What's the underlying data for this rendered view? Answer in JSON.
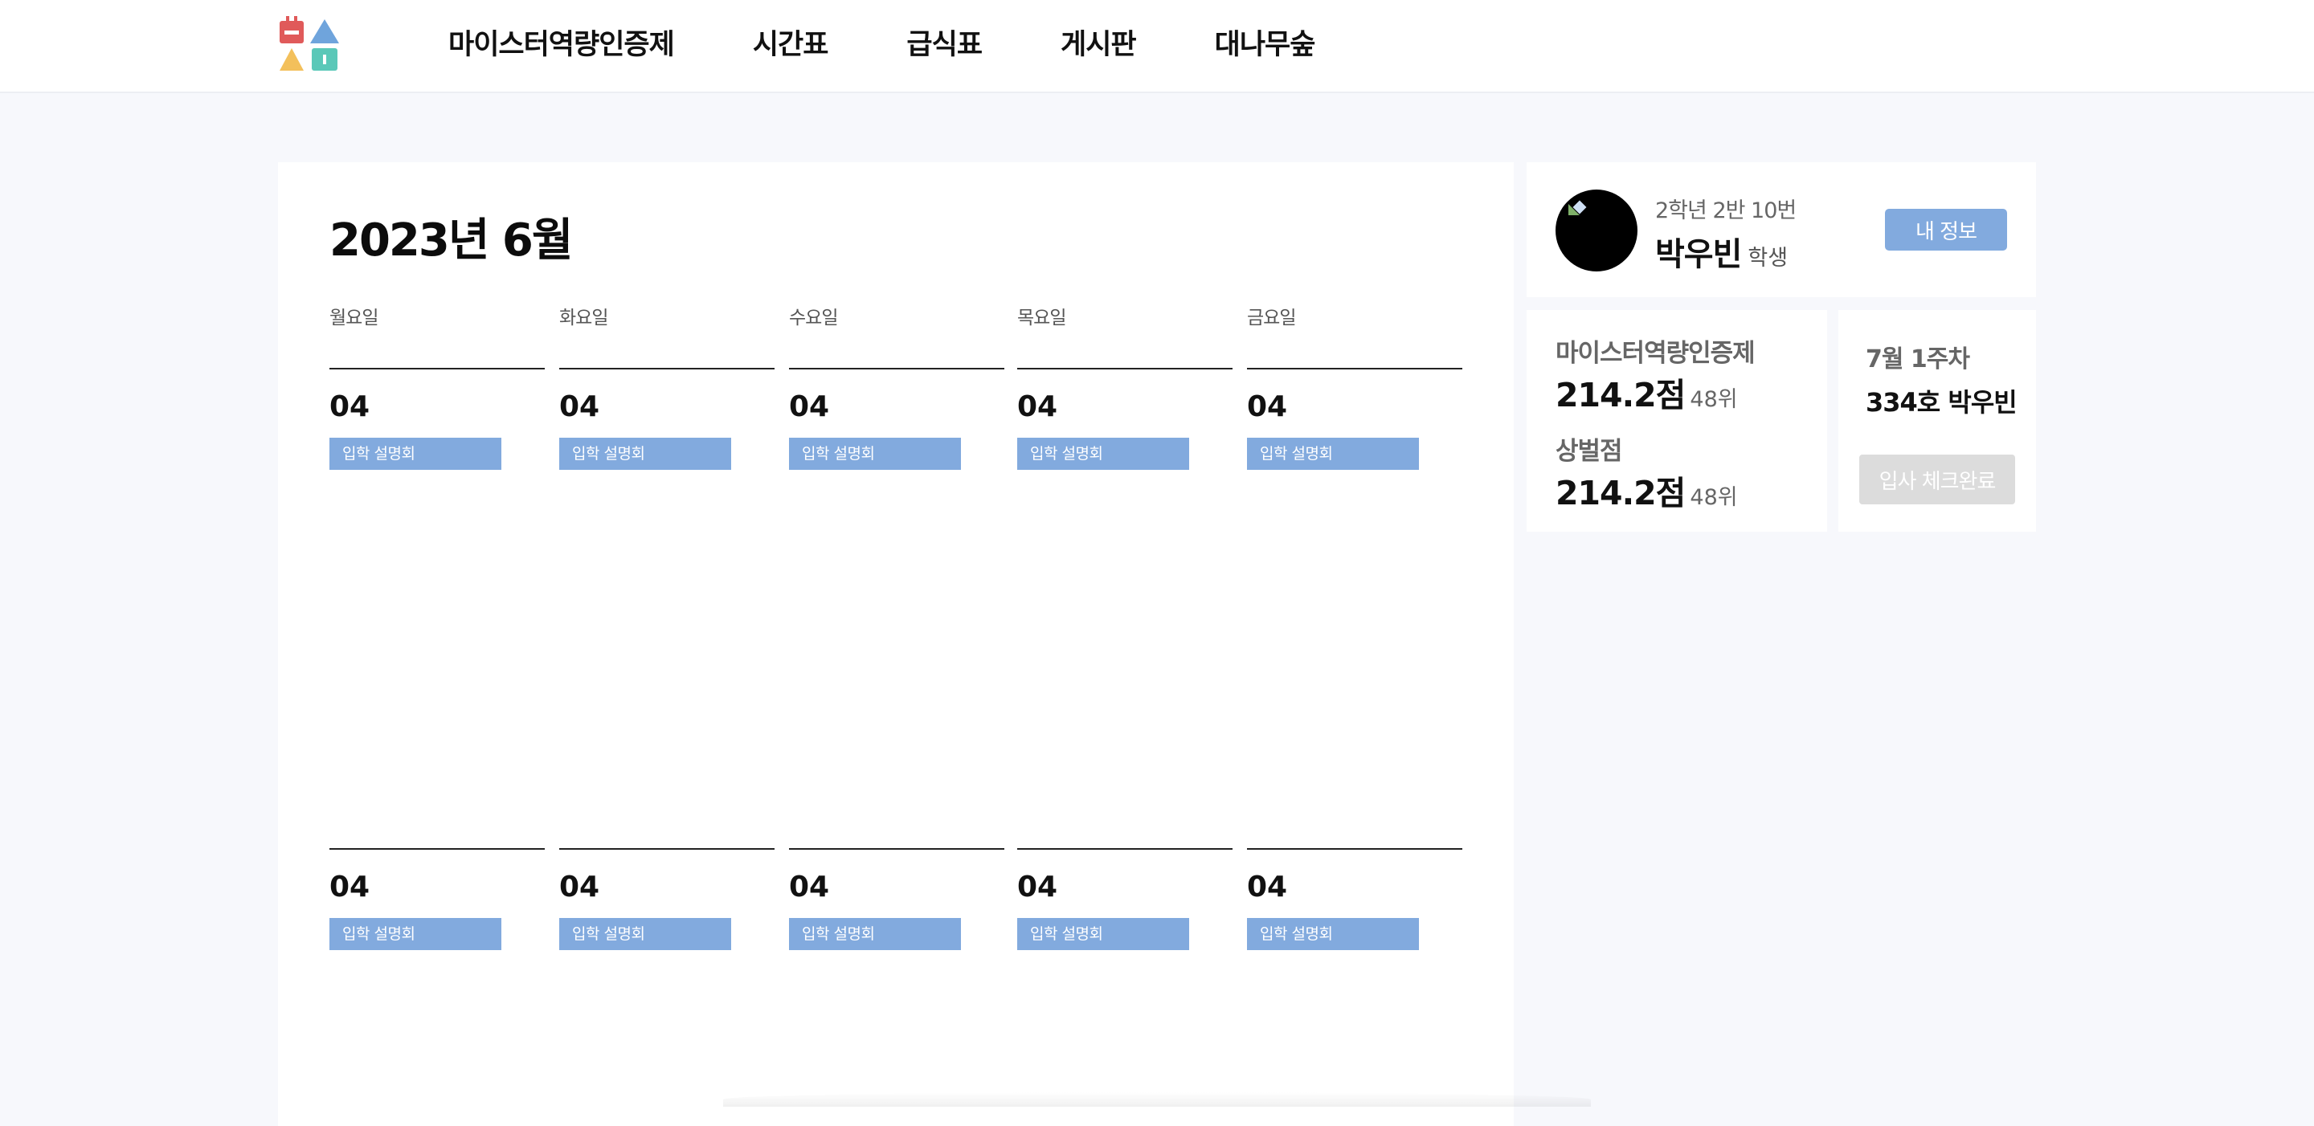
{
  "nav": {
    "items": [
      {
        "label": "마이스터역량인증제"
      },
      {
        "label": "시간표"
      },
      {
        "label": "급식표"
      },
      {
        "label": "게시판"
      },
      {
        "label": "대나무숲"
      }
    ]
  },
  "calendar": {
    "title": "2023년 6월",
    "weekdays": [
      "월요일",
      "화요일",
      "수요일",
      "목요일",
      "금요일"
    ],
    "weeks": [
      {
        "days": [
          {
            "date": "04",
            "event": "입학 설명회"
          },
          {
            "date": "04",
            "event": "입학 설명회"
          },
          {
            "date": "04",
            "event": "입학 설명회"
          },
          {
            "date": "04",
            "event": "입학 설명회"
          },
          {
            "date": "04",
            "event": "입학 설명회"
          }
        ]
      },
      {
        "days": [
          {
            "date": "04",
            "event": "입학 설명회"
          },
          {
            "date": "04",
            "event": "입학 설명회"
          },
          {
            "date": "04",
            "event": "입학 설명회"
          },
          {
            "date": "04",
            "event": "입학 설명회"
          },
          {
            "date": "04",
            "event": "입학 설명회"
          }
        ]
      }
    ]
  },
  "profile": {
    "class_info": "2학년 2반 10번",
    "name": "박우빈",
    "role": "학생",
    "my_info_label": "내 정보"
  },
  "stats": {
    "meister_label": "마이스터역량인증제",
    "meister_score": "214.2점",
    "meister_rank": "48위",
    "merit_label": "상벌점",
    "merit_score": "214.2점",
    "merit_rank": "48위"
  },
  "dorm": {
    "week_label": "7월 1주차",
    "room_label": "334호 박우빈",
    "check_label": "입사 체크완료"
  },
  "colors": {
    "accent": "#82aade",
    "background": "#f7f8fc",
    "disabled": "#dcdcdc"
  }
}
